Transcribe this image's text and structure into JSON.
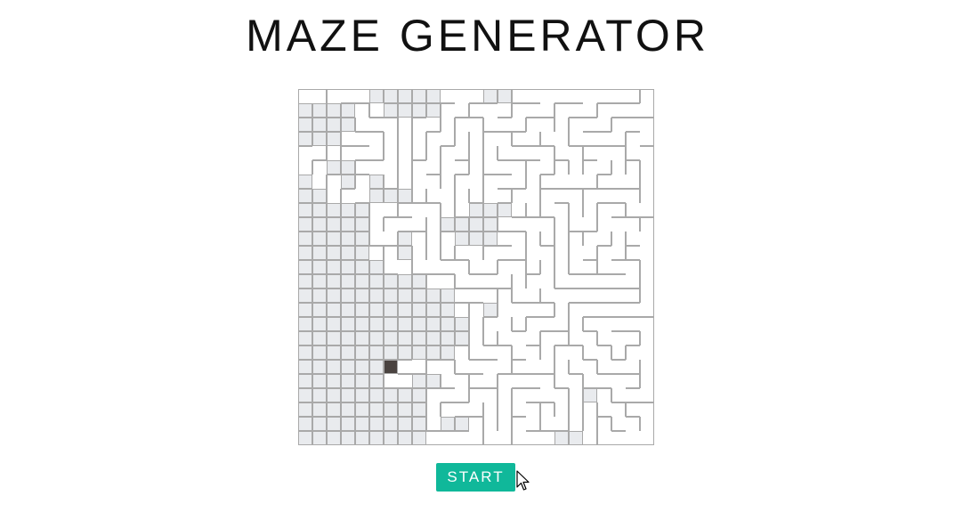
{
  "header": {
    "title": "MAZE GENERATOR"
  },
  "controls": {
    "start_label": "START"
  },
  "colors": {
    "wall": "#a9a9a9",
    "visited": "#e9ebee",
    "current": "#4a4340",
    "button": "#10b89a"
  },
  "maze": {
    "rows": 25,
    "cols": 25,
    "current_cell": [
      19,
      6
    ],
    "visited_cells": [
      [
        0,
        5
      ],
      [
        0,
        6
      ],
      [
        0,
        7
      ],
      [
        0,
        8
      ],
      [
        0,
        9
      ],
      [
        0,
        13
      ],
      [
        0,
        14
      ],
      [
        1,
        6
      ],
      [
        1,
        7
      ],
      [
        1,
        8
      ],
      [
        1,
        9
      ],
      [
        1,
        0
      ],
      [
        1,
        1
      ],
      [
        1,
        2
      ],
      [
        1,
        3
      ],
      [
        2,
        0
      ],
      [
        2,
        1
      ],
      [
        2,
        2
      ],
      [
        2,
        3
      ],
      [
        3,
        0
      ],
      [
        3,
        1
      ],
      [
        3,
        2
      ],
      [
        5,
        2
      ],
      [
        5,
        3
      ],
      [
        6,
        0
      ],
      [
        6,
        3
      ],
      [
        6,
        5
      ],
      [
        7,
        0
      ],
      [
        7,
        1
      ],
      [
        7,
        5
      ],
      [
        7,
        6
      ],
      [
        7,
        7
      ],
      [
        8,
        0
      ],
      [
        8,
        1
      ],
      [
        8,
        2
      ],
      [
        8,
        3
      ],
      [
        8,
        4
      ],
      [
        8,
        12
      ],
      [
        8,
        13
      ],
      [
        8,
        14
      ],
      [
        9,
        0
      ],
      [
        9,
        1
      ],
      [
        9,
        2
      ],
      [
        9,
        3
      ],
      [
        9,
        4
      ],
      [
        9,
        10
      ],
      [
        9,
        11
      ],
      [
        9,
        12
      ],
      [
        9,
        13
      ],
      [
        10,
        0
      ],
      [
        10,
        1
      ],
      [
        10,
        2
      ],
      [
        10,
        3
      ],
      [
        10,
        4
      ],
      [
        10,
        7
      ],
      [
        10,
        11
      ],
      [
        10,
        12
      ],
      [
        10,
        13
      ],
      [
        11,
        0
      ],
      [
        11,
        1
      ],
      [
        11,
        2
      ],
      [
        11,
        3
      ],
      [
        11,
        4
      ],
      [
        11,
        7
      ],
      [
        12,
        0
      ],
      [
        12,
        1
      ],
      [
        12,
        2
      ],
      [
        12,
        3
      ],
      [
        12,
        4
      ],
      [
        12,
        5
      ],
      [
        13,
        0
      ],
      [
        13,
        1
      ],
      [
        13,
        2
      ],
      [
        13,
        3
      ],
      [
        13,
        4
      ],
      [
        13,
        5
      ],
      [
        13,
        6
      ],
      [
        13,
        7
      ],
      [
        13,
        8
      ],
      [
        14,
        0
      ],
      [
        14,
        1
      ],
      [
        14,
        2
      ],
      [
        14,
        3
      ],
      [
        14,
        4
      ],
      [
        14,
        5
      ],
      [
        14,
        6
      ],
      [
        14,
        7
      ],
      [
        14,
        8
      ],
      [
        14,
        9
      ],
      [
        14,
        10
      ],
      [
        15,
        0
      ],
      [
        15,
        1
      ],
      [
        15,
        2
      ],
      [
        15,
        3
      ],
      [
        15,
        4
      ],
      [
        15,
        5
      ],
      [
        15,
        6
      ],
      [
        15,
        7
      ],
      [
        15,
        8
      ],
      [
        15,
        9
      ],
      [
        15,
        10
      ],
      [
        15,
        13
      ],
      [
        16,
        0
      ],
      [
        16,
        1
      ],
      [
        16,
        2
      ],
      [
        16,
        3
      ],
      [
        16,
        4
      ],
      [
        16,
        5
      ],
      [
        16,
        6
      ],
      [
        16,
        7
      ],
      [
        16,
        8
      ],
      [
        16,
        9
      ],
      [
        16,
        10
      ],
      [
        16,
        11
      ],
      [
        17,
        0
      ],
      [
        17,
        1
      ],
      [
        17,
        2
      ],
      [
        17,
        3
      ],
      [
        17,
        4
      ],
      [
        17,
        5
      ],
      [
        17,
        6
      ],
      [
        17,
        7
      ],
      [
        17,
        8
      ],
      [
        17,
        9
      ],
      [
        17,
        10
      ],
      [
        17,
        11
      ],
      [
        18,
        0
      ],
      [
        18,
        1
      ],
      [
        18,
        2
      ],
      [
        18,
        3
      ],
      [
        18,
        4
      ],
      [
        18,
        5
      ],
      [
        18,
        6
      ],
      [
        18,
        7
      ],
      [
        18,
        8
      ],
      [
        18,
        9
      ],
      [
        18,
        10
      ],
      [
        19,
        0
      ],
      [
        19,
        1
      ],
      [
        19,
        2
      ],
      [
        19,
        3
      ],
      [
        19,
        4
      ],
      [
        19,
        5
      ],
      [
        20,
        0
      ],
      [
        20,
        1
      ],
      [
        20,
        2
      ],
      [
        20,
        3
      ],
      [
        20,
        4
      ],
      [
        20,
        5
      ],
      [
        20,
        8
      ],
      [
        20,
        9
      ],
      [
        21,
        0
      ],
      [
        21,
        1
      ],
      [
        21,
        2
      ],
      [
        21,
        3
      ],
      [
        21,
        4
      ],
      [
        21,
        5
      ],
      [
        21,
        6
      ],
      [
        21,
        7
      ],
      [
        21,
        8
      ],
      [
        21,
        20
      ],
      [
        22,
        0
      ],
      [
        22,
        1
      ],
      [
        22,
        2
      ],
      [
        22,
        3
      ],
      [
        22,
        4
      ],
      [
        22,
        5
      ],
      [
        22,
        6
      ],
      [
        22,
        7
      ],
      [
        22,
        8
      ],
      [
        23,
        0
      ],
      [
        23,
        1
      ],
      [
        23,
        2
      ],
      [
        23,
        3
      ],
      [
        23,
        4
      ],
      [
        23,
        5
      ],
      [
        23,
        6
      ],
      [
        23,
        7
      ],
      [
        23,
        8
      ],
      [
        23,
        10
      ],
      [
        23,
        11
      ],
      [
        24,
        0
      ],
      [
        24,
        1
      ],
      [
        24,
        2
      ],
      [
        24,
        3
      ],
      [
        24,
        4
      ],
      [
        24,
        5
      ],
      [
        24,
        6
      ],
      [
        24,
        7
      ],
      [
        24,
        8
      ],
      [
        24,
        18
      ],
      [
        24,
        19
      ]
    ]
  }
}
